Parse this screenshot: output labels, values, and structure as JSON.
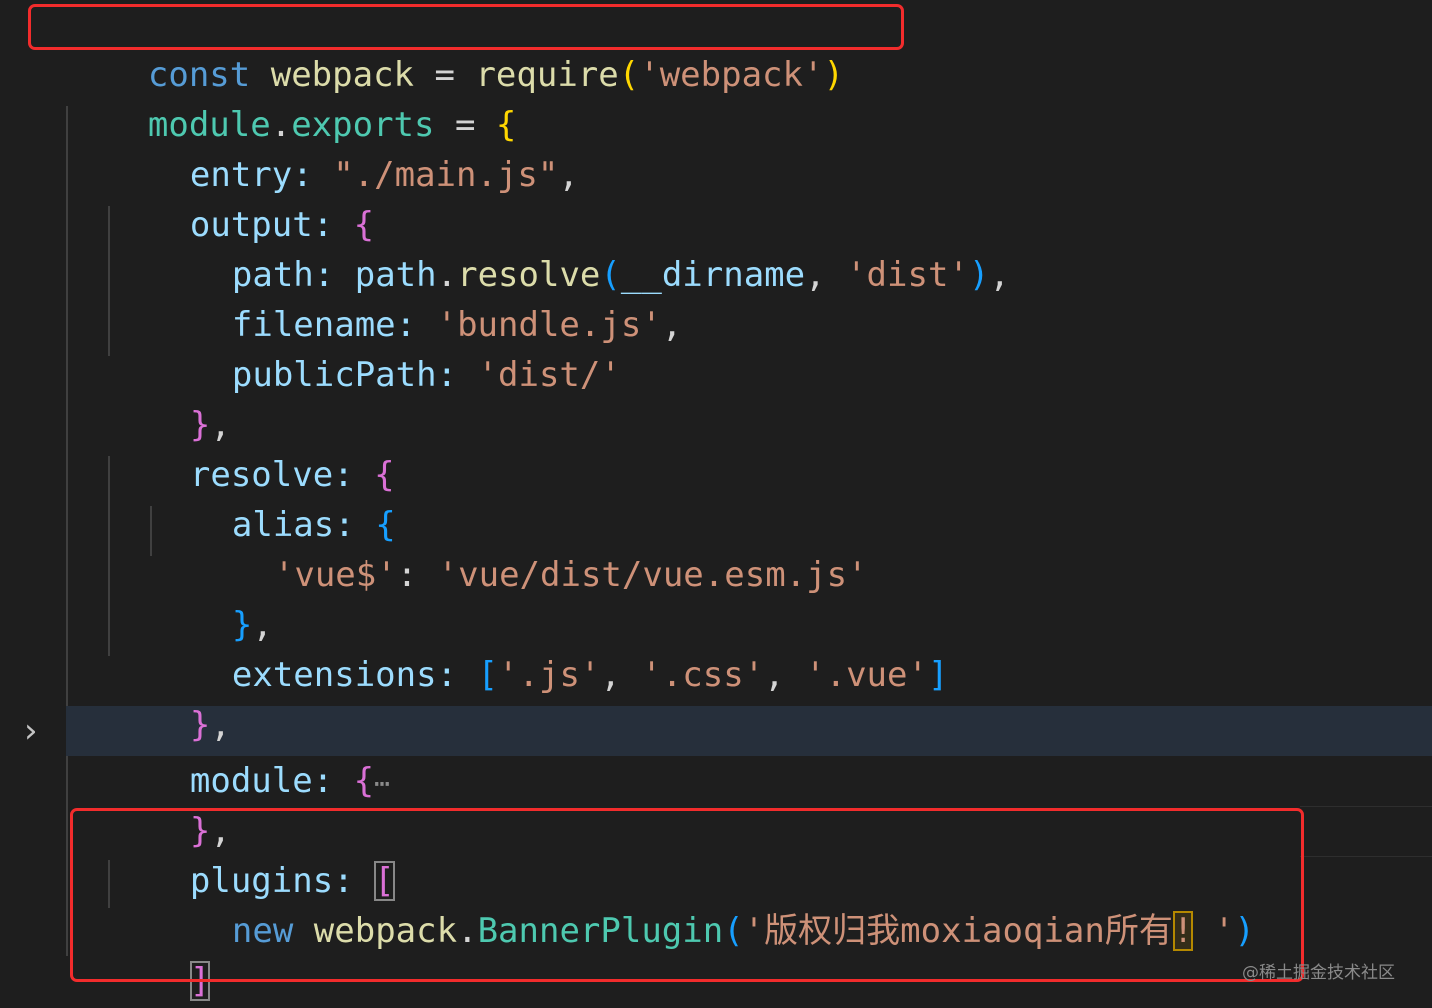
{
  "editor": {
    "fold_chevron": "›",
    "watermark": "@稀土掘金技术社区"
  },
  "code": {
    "l1": {
      "kw": "const",
      "name": "webpack",
      "eq": " = ",
      "fn": "require",
      "open": "(",
      "str": "'webpack'",
      "close": ")"
    },
    "l2": {
      "obj": "module",
      "dot": ".",
      "prop": "exports",
      "eq": " = ",
      "brace": "{"
    },
    "l3": {
      "key": "entry",
      "colon": ": ",
      "str": "\"./main.js\"",
      "comma": ","
    },
    "l4": {
      "key": "output",
      "colon": ": ",
      "brace": "{"
    },
    "l5": {
      "key": "path",
      "colon": ": ",
      "obj": "path",
      "dot": ".",
      "fn": "resolve",
      "open": "(",
      "arg": "__dirname",
      "sep": ", ",
      "str": "'dist'",
      "close": ")",
      "comma": ","
    },
    "l6": {
      "key": "filename",
      "colon": ": ",
      "str": "'bundle.js'",
      "comma": ","
    },
    "l7": {
      "key": "publicPath",
      "colon": ": ",
      "str": "'dist/'"
    },
    "l8": {
      "brace": "}",
      "comma": ","
    },
    "l9": {
      "key": "resolve",
      "colon": ": ",
      "brace": "{"
    },
    "l10": {
      "key": "alias",
      "colon": ": ",
      "brace": "{"
    },
    "l11": {
      "key": "'vue$'",
      "colon": ": ",
      "str": "'vue/dist/vue.esm.js'"
    },
    "l12": {
      "brace": "}",
      "comma": ","
    },
    "l13": {
      "key": "extensions",
      "colon": ": ",
      "open": "[",
      "s1": "'.js'",
      "c1": ", ",
      "s2": "'.css'",
      "c2": ", ",
      "s3": "'.vue'",
      "close": "]"
    },
    "l14": {
      "brace": "}",
      "comma": ","
    },
    "l15": {
      "key": "module",
      "colon": ": ",
      "brace": "{",
      "ellipsis": "⋯"
    },
    "l16": {
      "brace": "}",
      "comma": ","
    },
    "l17": {
      "key": "plugins",
      "colon": ": ",
      "open": "["
    },
    "l18": {
      "kw": "new",
      "obj": "webpack",
      "dot": ".",
      "cls": "BannerPlugin",
      "open": "(",
      "str_a": "'版权归我moxiaoqian所有",
      "str_b": "!",
      "str_c": " '",
      "close": ")"
    },
    "l19": {
      "close": "]"
    },
    "l20": {
      "brace": "}"
    }
  }
}
